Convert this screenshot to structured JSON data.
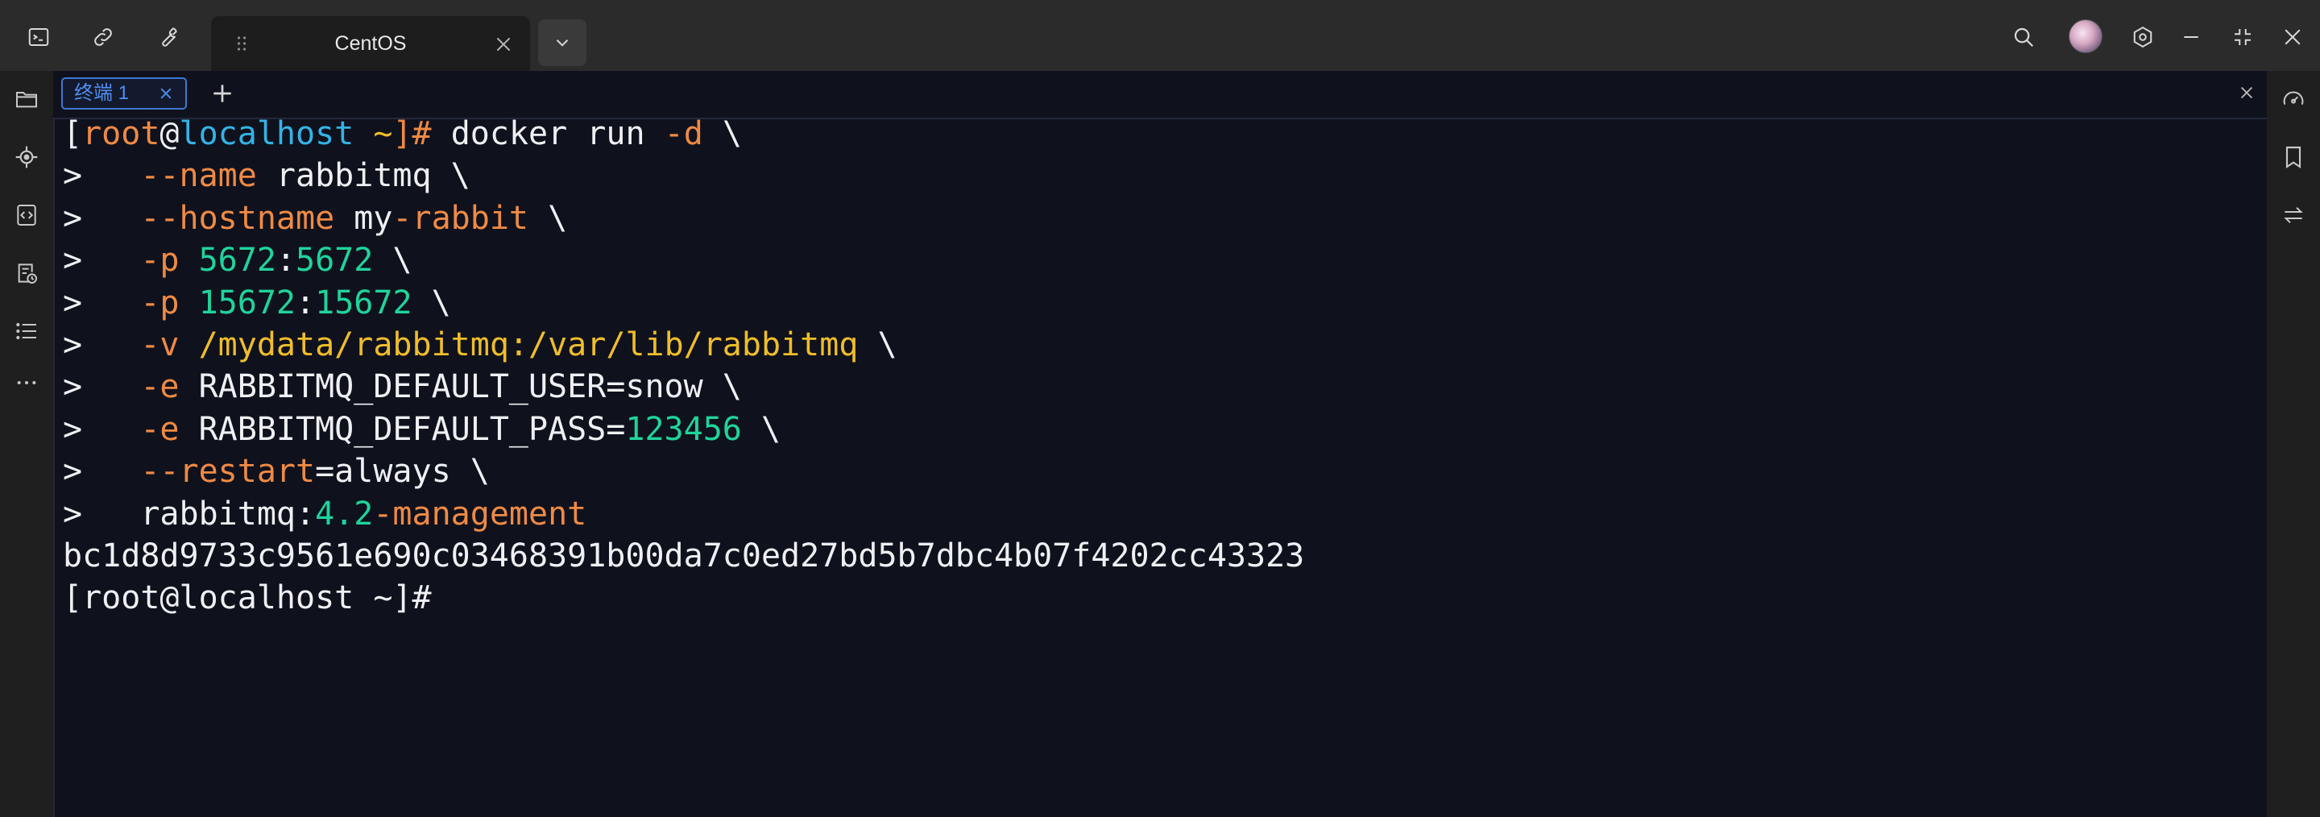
{
  "window": {
    "tab_title": "CentOS"
  },
  "icons": {
    "top_left": [
      "terminal-icon",
      "link-icon",
      "wrench-icon"
    ],
    "top_right": [
      "search-icon",
      "avatar",
      "settings-icon",
      "minimize-icon",
      "restore-icon",
      "close-icon"
    ],
    "left_sidebar": [
      "folder-icon",
      "target-icon",
      "code-icon",
      "history-icon",
      "list-icon",
      "more-icon"
    ],
    "right_sidebar": [
      "speedometer-icon",
      "bookmark-icon",
      "transfer-icon"
    ]
  },
  "terminal_tabs": {
    "active_label": "终端 1"
  },
  "terminal": {
    "lines": [
      [
        [
          "c-w",
          "["
        ],
        [
          "c-o",
          "root"
        ],
        [
          "c-w",
          "@"
        ],
        [
          "c-b",
          "localhost"
        ],
        [
          "c-w",
          " "
        ],
        [
          "c-y",
          "~"
        ],
        [
          "c-o",
          "]#"
        ],
        [
          "c-w",
          " docker run "
        ],
        [
          "c-o",
          "-d"
        ],
        [
          "c-w",
          " \\"
        ]
      ],
      [
        [
          "c-w",
          ">   "
        ],
        [
          "c-o",
          "--name"
        ],
        [
          "c-w",
          " rabbitmq \\"
        ]
      ],
      [
        [
          "c-w",
          ">   "
        ],
        [
          "c-o",
          "--hostname"
        ],
        [
          "c-w",
          " my"
        ],
        [
          "c-o",
          "-rabbit"
        ],
        [
          "c-w",
          " \\"
        ]
      ],
      [
        [
          "c-w",
          ">   "
        ],
        [
          "c-o",
          "-p"
        ],
        [
          "c-w",
          " "
        ],
        [
          "c-g",
          "5672"
        ],
        [
          "c-w",
          ":"
        ],
        [
          "c-g",
          "5672"
        ],
        [
          "c-w",
          " \\"
        ]
      ],
      [
        [
          "c-w",
          ">   "
        ],
        [
          "c-o",
          "-p"
        ],
        [
          "c-w",
          " "
        ],
        [
          "c-g",
          "15672"
        ],
        [
          "c-w",
          ":"
        ],
        [
          "c-g",
          "15672"
        ],
        [
          "c-w",
          " \\"
        ]
      ],
      [
        [
          "c-w",
          ">   "
        ],
        [
          "c-o",
          "-v"
        ],
        [
          "c-w",
          " "
        ],
        [
          "c-y",
          "/mydata/rabbitmq:/var/lib/rabbitmq"
        ],
        [
          "c-w",
          " \\"
        ]
      ],
      [
        [
          "c-w",
          ">   "
        ],
        [
          "c-o",
          "-e"
        ],
        [
          "c-w",
          " RABBITMQ_DEFAULT_USER=snow \\"
        ]
      ],
      [
        [
          "c-w",
          ">   "
        ],
        [
          "c-o",
          "-e"
        ],
        [
          "c-w",
          " RABBITMQ_DEFAULT_PASS="
        ],
        [
          "c-g",
          "123456"
        ],
        [
          "c-w",
          " \\"
        ]
      ],
      [
        [
          "c-w",
          ">   "
        ],
        [
          "c-o",
          "--restart"
        ],
        [
          "c-w",
          "=always \\"
        ]
      ],
      [
        [
          "c-w",
          ">   rabbitmq:"
        ],
        [
          "c-g",
          "4.2"
        ],
        [
          "c-o",
          "-management"
        ]
      ],
      [
        [
          "c-w",
          "bc1d8d9733c9561e690c03468391b00da7c0ed27bd5b7dbc4b07f4202cc43323"
        ]
      ],
      [
        [
          "c-w",
          "[root@localhost ~]#"
        ]
      ]
    ]
  },
  "colors": {
    "terminal_bg": "#0f121d",
    "orange": "#ef8a44",
    "blue": "#34b3e6",
    "yellow": "#f0bd2a",
    "green": "#1fd49b",
    "tab_accent": "#3f78d4"
  }
}
